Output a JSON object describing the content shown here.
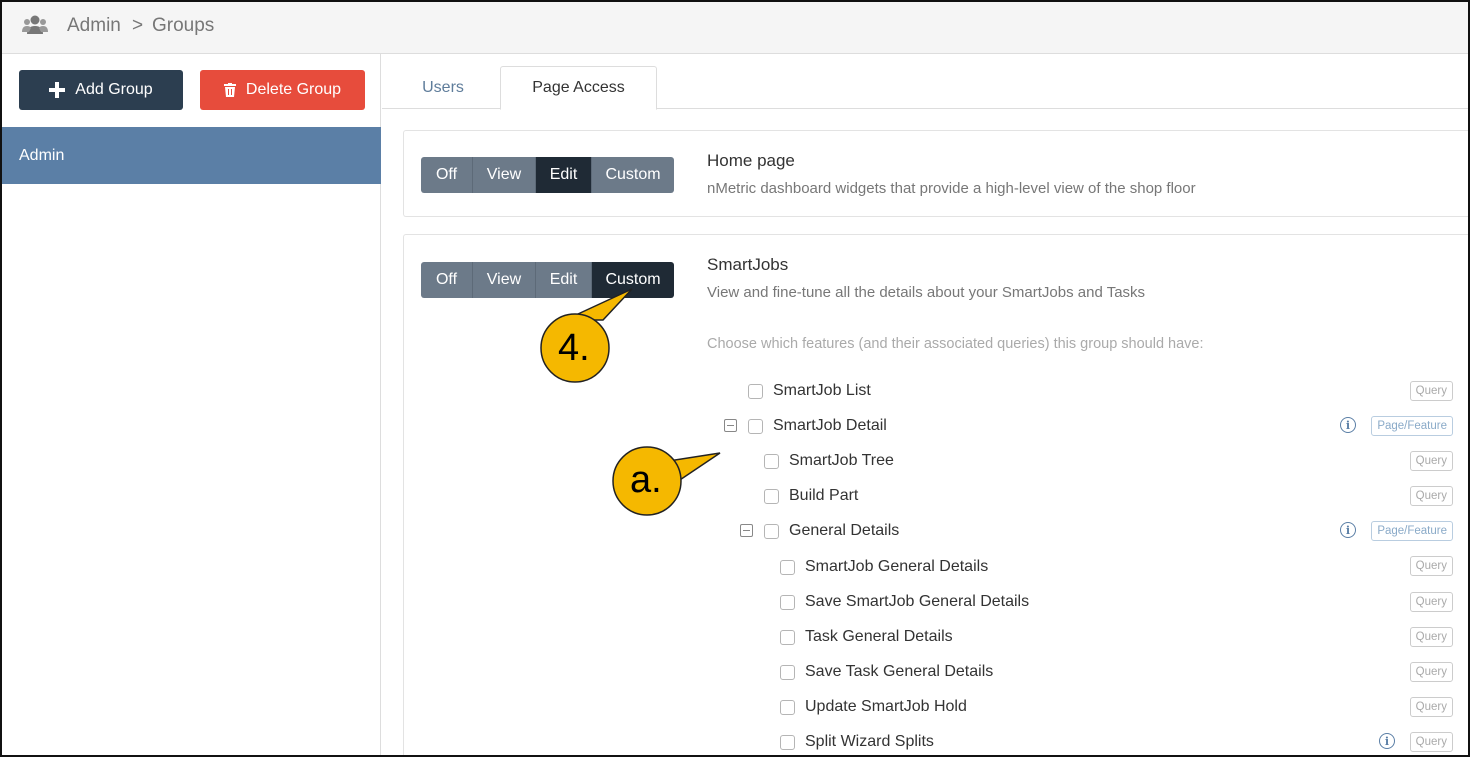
{
  "breadcrumb": {
    "root": "Admin",
    "separator": ">",
    "current": "Groups"
  },
  "sidebar": {
    "add_group": "Add Group",
    "delete_group": "Delete Group",
    "groups": [
      "Admin"
    ]
  },
  "tabs": {
    "users": "Users",
    "page_access": "Page Access"
  },
  "access_levels": {
    "off": "Off",
    "view": "View",
    "edit": "Edit",
    "custom": "Custom"
  },
  "pages": [
    {
      "title": "Home page",
      "description": "nMetric dashboard widgets that provide a high-level view of the shop floor",
      "selected": "Edit"
    },
    {
      "title": "SmartJobs",
      "description": "View and fine-tune all the details about your SmartJobs and Tasks",
      "selected": "Custom",
      "note": "Choose which features (and their associated queries) this group should have:"
    }
  ],
  "features": [
    {
      "label": "SmartJob List",
      "badge": "Query"
    },
    {
      "label": "SmartJob Detail",
      "badge": "Page/Feature"
    },
    {
      "label": "SmartJob Tree",
      "badge": "Query"
    },
    {
      "label": "Build Part",
      "badge": "Query"
    },
    {
      "label": "General Details",
      "badge": "Page/Feature"
    },
    {
      "label": "SmartJob General Details",
      "badge": "Query"
    },
    {
      "label": "Save SmartJob General Details",
      "badge": "Query"
    },
    {
      "label": "Task General Details",
      "badge": "Query"
    },
    {
      "label": "Save Task General Details",
      "badge": "Query"
    },
    {
      "label": "Update SmartJob Hold",
      "badge": "Query"
    },
    {
      "label": "Split Wizard Splits",
      "badge": "Query"
    }
  ],
  "callouts": {
    "step": "4.",
    "sub": "a."
  },
  "colors": {
    "accent": "#f5b800",
    "selected_group": "#5b7fa6",
    "add_button": "#2c3e50",
    "delete_button": "#e74c3c",
    "segment": "#6c7a89",
    "segment_active": "#1f2a35"
  }
}
